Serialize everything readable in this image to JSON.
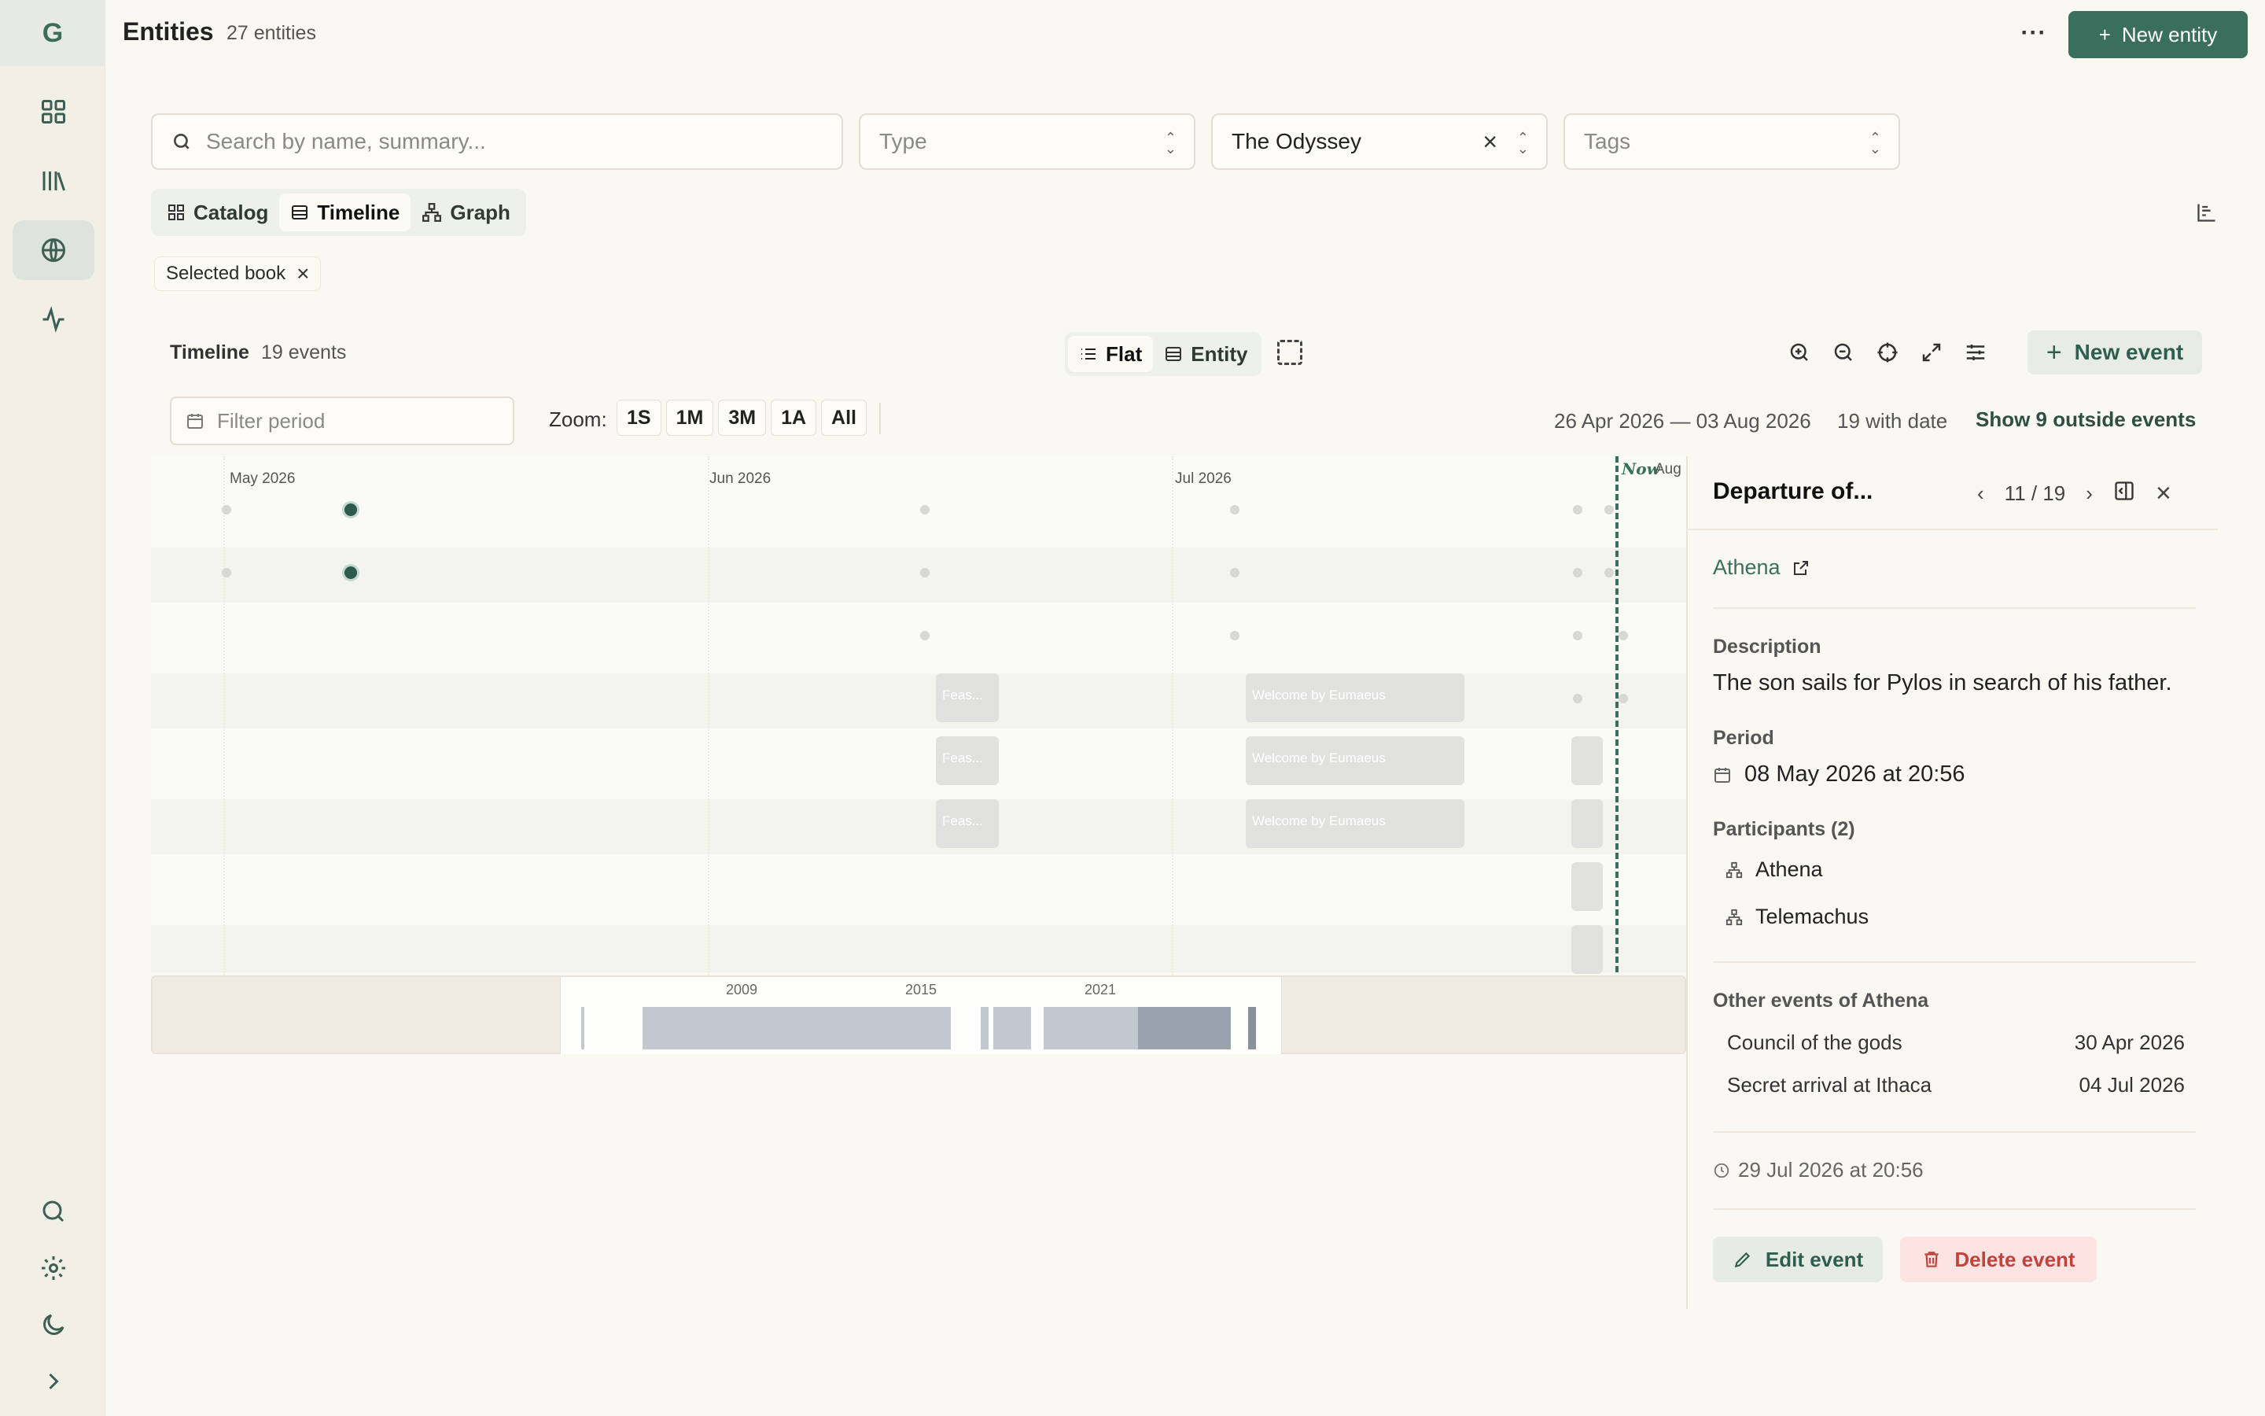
{
  "rail": {
    "logo": "G"
  },
  "header": {
    "title": "Entities",
    "count": "27 entities",
    "more": "···",
    "new_entity": "New entity"
  },
  "filters": {
    "search_placeholder": "Search by name, summary...",
    "type_placeholder": "Type",
    "book_value": "The Odyssey",
    "tags_placeholder": "Tags"
  },
  "views": {
    "catalog": "Catalog",
    "timeline": "Timeline",
    "graph": "Graph"
  },
  "chip": {
    "label": "Selected book"
  },
  "timeline": {
    "title": "Timeline",
    "count": "19 events",
    "mode_flat": "Flat",
    "mode_entity": "Entity",
    "new_event": "New event",
    "filter_placeholder": "Filter period",
    "zoom_label": "Zoom:",
    "zoom_options": [
      "1S",
      "1M",
      "3M",
      "1A",
      "All"
    ],
    "range": "26 Apr 2026 — 03 Aug 2026",
    "with_date": "19 with date",
    "outside": "Show 9 outside events",
    "months": [
      "May 2026",
      "Jun 2026",
      "Jul 2026"
    ],
    "now": "Now",
    "aug": "Aug",
    "bars": [
      "Feas...",
      "Welcome by Eumaeus"
    ],
    "minimap_years": [
      "2009",
      "2015",
      "2021"
    ]
  },
  "detail": {
    "title": "Departure of...",
    "position": "11 / 19",
    "entity": "Athena",
    "description_label": "Description",
    "description": "The son sails for Pylos in search of his father.",
    "period_label": "Period",
    "period": "08 May 2026 at 20:56",
    "participants_label": "Participants (2)",
    "participants": [
      "Athena",
      "Telemachus"
    ],
    "other_label": "Other events of Athena",
    "other_events": [
      {
        "name": "Council of the gods",
        "date": "30 Apr 2026"
      },
      {
        "name": "Secret arrival at Ithaca",
        "date": "04 Jul 2026"
      }
    ],
    "timestamp": "29 Jul 2026 at 20:56",
    "edit": "Edit event",
    "delete": "Delete event"
  },
  "colors": {
    "accent": "#3b6f5d",
    "danger": "#c0433e",
    "background": "#faf8f3"
  }
}
